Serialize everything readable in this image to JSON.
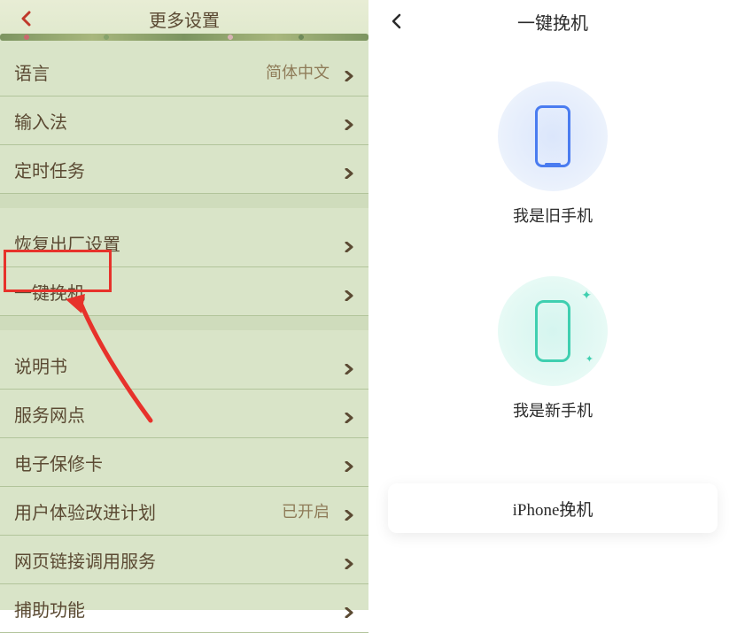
{
  "left": {
    "title": "更多设置",
    "groups": [
      [
        {
          "label": "语言",
          "value": "简体中文"
        },
        {
          "label": "输入法"
        },
        {
          "label": "定时任务"
        }
      ],
      [
        {
          "label": "恢复出厂设置"
        },
        {
          "label": "一键挽机"
        }
      ],
      [
        {
          "label": "说明书"
        },
        {
          "label": "服务网点"
        },
        {
          "label": "电子保修卡"
        },
        {
          "label": "用户体验改进计划",
          "value": "已开启"
        },
        {
          "label": "网页链接调用服务"
        },
        {
          "label": "捕助功能"
        }
      ]
    ]
  },
  "right": {
    "title": "一键挽机",
    "old_phone_label": "我是旧手机",
    "new_phone_label": "我是新手机",
    "iphone_label": "iPhone挽机"
  }
}
